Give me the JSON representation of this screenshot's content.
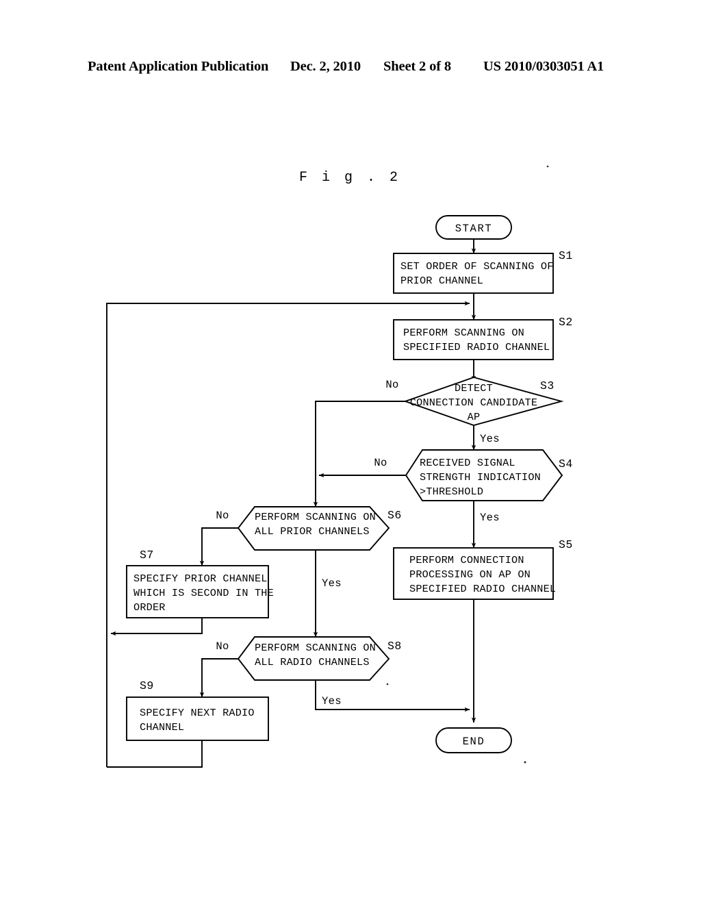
{
  "header": {
    "publication": "Patent Application Publication",
    "date": "Dec. 2, 2010",
    "sheet": "Sheet 2 of 8",
    "number": "US 2010/0303051 A1"
  },
  "figure": {
    "caption": "F i g .  2"
  },
  "flowchart": {
    "type": "flowchart",
    "terminators": {
      "start": "START",
      "end": "END"
    },
    "branch_labels": {
      "yes": "Yes",
      "no": "No"
    },
    "nodes": [
      {
        "id": "S1",
        "label": "S1",
        "shape": "process",
        "lines": [
          "SET ORDER OF SCANNING OF",
          "PRIOR CHANNEL"
        ]
      },
      {
        "id": "S2",
        "label": "S2",
        "shape": "process",
        "lines": [
          "PERFORM SCANNING ON",
          "SPECIFIED RADIO CHANNEL"
        ]
      },
      {
        "id": "S3",
        "label": "S3",
        "shape": "decision-diamond",
        "lines": [
          "DETECT",
          "CONNECTION CANDIDATE",
          "AP"
        ]
      },
      {
        "id": "S4",
        "label": "S4",
        "shape": "decision-hexagon",
        "lines": [
          "RECEIVED SIGNAL",
          "STRENGTH INDICATION",
          ">THRESHOLD"
        ]
      },
      {
        "id": "S5",
        "label": "S5",
        "shape": "process",
        "lines": [
          "PERFORM CONNECTION",
          "PROCESSING ON AP ON",
          "SPECIFIED RADIO CHANNEL"
        ]
      },
      {
        "id": "S6",
        "label": "S6",
        "shape": "decision-hexagon",
        "lines": [
          "PERFORM SCANNING ON",
          "ALL PRIOR CHANNELS"
        ]
      },
      {
        "id": "S7",
        "label": "S7",
        "shape": "process",
        "lines": [
          "SPECIFY PRIOR CHANNEL",
          "WHICH IS SECOND IN THE",
          "ORDER"
        ]
      },
      {
        "id": "S8",
        "label": "S8",
        "shape": "decision-hexagon",
        "lines": [
          "PERFORM SCANNING ON",
          "ALL RADIO CHANNELS"
        ]
      },
      {
        "id": "S9",
        "label": "S9",
        "shape": "process",
        "lines": [
          "SPECIFY NEXT RADIO",
          "CHANNEL"
        ]
      }
    ],
    "edges": [
      {
        "from": "START",
        "to": "S1",
        "label": ""
      },
      {
        "from": "S1",
        "to": "S2",
        "label": ""
      },
      {
        "from": "S2",
        "to": "S3",
        "label": ""
      },
      {
        "from": "S3",
        "to": "S4",
        "label": "Yes"
      },
      {
        "from": "S3",
        "to": "S6",
        "label": "No"
      },
      {
        "from": "S4",
        "to": "S5",
        "label": "Yes"
      },
      {
        "from": "S4",
        "to": "S6",
        "label": "No"
      },
      {
        "from": "S5",
        "to": "END",
        "label": ""
      },
      {
        "from": "S6",
        "to": "S8",
        "label": "Yes"
      },
      {
        "from": "S6",
        "to": "S7",
        "label": "No"
      },
      {
        "from": "S7",
        "to": "S2",
        "label": ""
      },
      {
        "from": "S8",
        "to": "END",
        "label": "Yes"
      },
      {
        "from": "S8",
        "to": "S9",
        "label": "No"
      },
      {
        "from": "S9",
        "to": "S2",
        "label": ""
      }
    ]
  },
  "colors": {
    "ink": "#000000",
    "paper": "#ffffff"
  }
}
